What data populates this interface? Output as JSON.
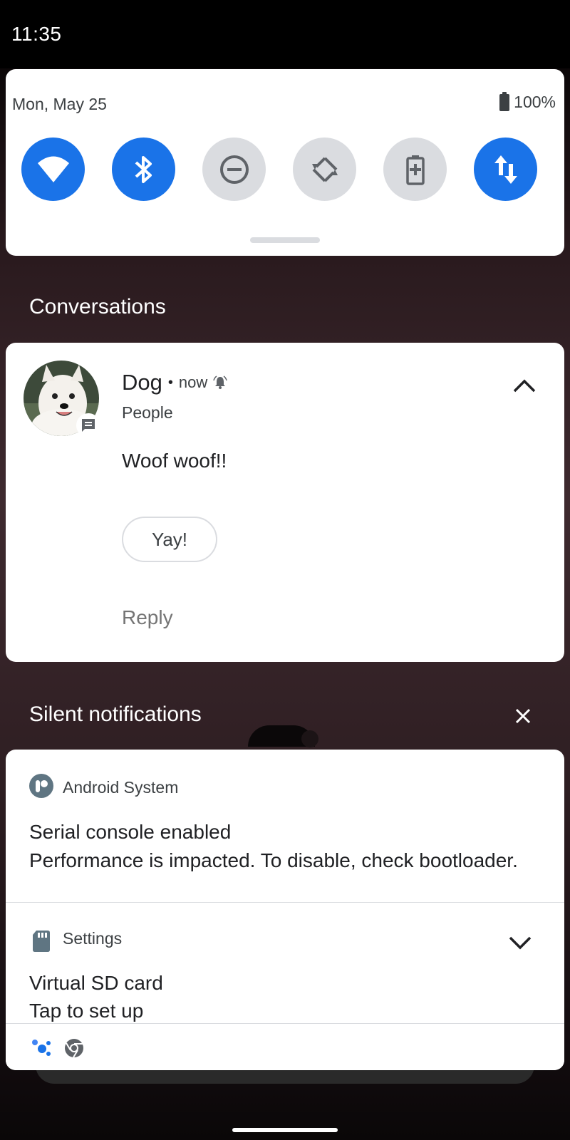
{
  "status_bar": {
    "time": "11:35"
  },
  "quick_settings": {
    "date": "Mon, May 25",
    "battery": "100%",
    "tiles": [
      {
        "name": "wifi-icon",
        "state": "on"
      },
      {
        "name": "bluetooth-icon",
        "state": "on"
      },
      {
        "name": "do-not-disturb-icon",
        "state": "off"
      },
      {
        "name": "auto-rotate-icon",
        "state": "off"
      },
      {
        "name": "battery-saver-icon",
        "state": "off"
      },
      {
        "name": "mobile-data-icon",
        "state": "on"
      }
    ]
  },
  "conversations": {
    "header": "Conversations",
    "notification": {
      "sender": "Dog",
      "separator": "•",
      "time": "now",
      "subtitle": "People",
      "message": "Woof woof!!",
      "smart_reply": "Yay!",
      "reply_label": "Reply"
    }
  },
  "silent": {
    "header": "Silent notifications",
    "items": [
      {
        "app": "Android System",
        "title": "Serial console enabled",
        "text": "Performance is impacted. To disable, check bootloader."
      },
      {
        "app": "Settings",
        "title": "Virtual SD card",
        "text": "Tap to set up"
      }
    ]
  },
  "colors": {
    "accent": "#1a73e8",
    "tile_off": "#dadce0"
  }
}
